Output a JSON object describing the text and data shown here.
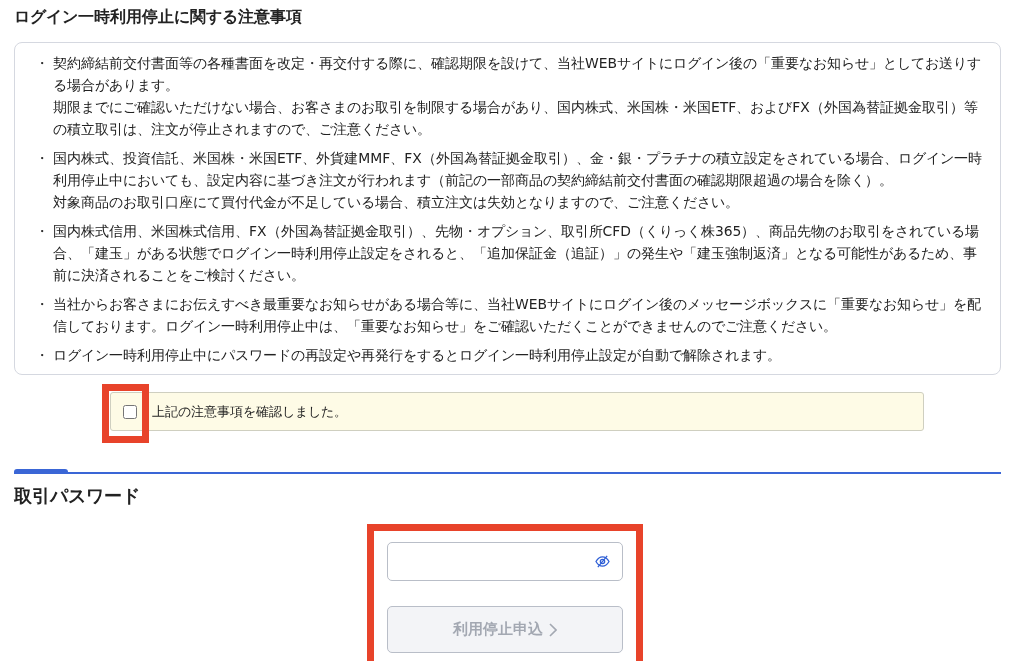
{
  "notice": {
    "title": "ログイン一時利用停止に関する注意事項",
    "items": [
      {
        "marker": "・",
        "paragraphs": [
          "契約締結前交付書面等の各種書面を改定・再交付する際に、確認期限を設けて、当社WEBサイトにログイン後の「重要なお知らせ」としてお送りする場合があります。",
          "期限までにご確認いただけない場合、お客さまのお取引を制限する場合があり、国内株式、米国株・米国ETF、およびFX（外国為替証拠金取引）等の積立取引は、注文が停止されますので、ご注意ください。"
        ]
      },
      {
        "marker": "・",
        "paragraphs": [
          "国内株式、投資信託、米国株・米国ETF、外貨建MMF、FX（外国為替証拠金取引）、金・銀・プラチナの積立設定をされている場合、ログイン一時利用停止中においても、設定内容に基づき注文が行われます（前記の一部商品の契約締結前交付書面の確認期限超過の場合を除く）。",
          "対象商品のお取引口座にて買付代金が不足している場合、積立注文は失効となりますので、ご注意ください。"
        ]
      },
      {
        "marker": "・",
        "paragraphs": [
          "国内株式信用、米国株式信用、FX（外国為替証拠金取引）、先物・オプション、取引所CFD（くりっく株365）、商品先物のお取引をされている場合、「建玉」がある状態でログイン一時利用停止設定をされると、「追加保証金（追証）」の発生や「建玉強制返済」となる可能性があるため、事前に決済されることをご検討ください。"
        ]
      },
      {
        "marker": "・",
        "paragraphs": [
          "当社からお客さまにお伝えすべき最重要なお知らせがある場合等に、当社WEBサイトにログイン後のメッセージボックスに「重要なお知らせ」を配信しております。ログイン一時利用停止中は、「重要なお知らせ」をご確認いただくことができませんのでご注意ください。"
        ]
      },
      {
        "marker": "・",
        "paragraphs": [
          "ログイン一時利用停止中にパスワードの再設定や再発行をするとログイン一時利用停止設定が自動で解除されます。"
        ]
      }
    ]
  },
  "confirm": {
    "label": "上記の注意事項を確認しました。",
    "checked": false,
    "highlighted": true
  },
  "password": {
    "title": "取引パスワード",
    "highlighted": true,
    "masked": true,
    "submit": {
      "label": "利用停止申込",
      "disabled": true
    }
  }
}
